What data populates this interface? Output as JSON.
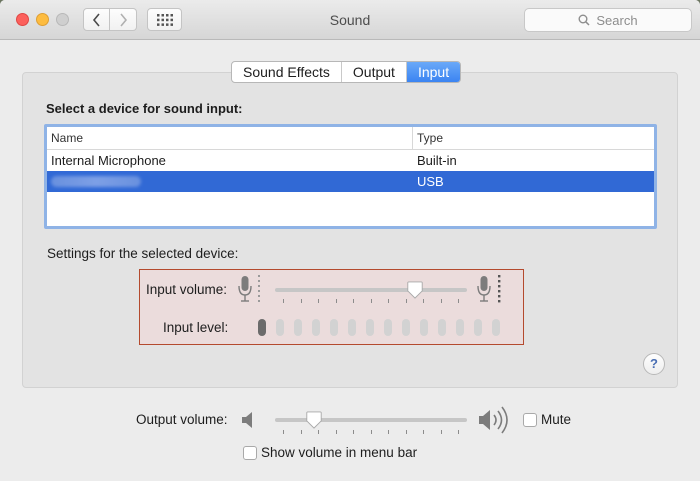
{
  "window": {
    "title": "Sound"
  },
  "search": {
    "placeholder": "Search"
  },
  "tabs": [
    {
      "label": "Sound Effects",
      "active": false
    },
    {
      "label": "Output",
      "active": false
    },
    {
      "label": "Input",
      "active": true
    }
  ],
  "device_section": {
    "heading": "Select a device for sound input:",
    "columns": {
      "name": "Name",
      "type": "Type"
    },
    "rows": [
      {
        "name": "Internal Microphone",
        "type": "Built-in",
        "selected": false
      },
      {
        "name": "",
        "type": "USB",
        "selected": true
      }
    ]
  },
  "settings": {
    "label": "Settings for the selected device:",
    "input_volume_label": "Input volume:",
    "input_volume": 0.75,
    "input_level_label": "Input level:",
    "input_level_lit": 1,
    "input_level_segments": 14
  },
  "output": {
    "volume_label": "Output volume:",
    "volume": 0.17,
    "mute_label": "Mute",
    "mute_checked": false,
    "show_in_menu_label": "Show volume in menu bar",
    "show_in_menu_checked": false
  },
  "help": {
    "label": "?"
  },
  "colors": {
    "accent": "#3b84f2",
    "selection": "#3169d5",
    "highlight_border": "#b44a2e"
  }
}
